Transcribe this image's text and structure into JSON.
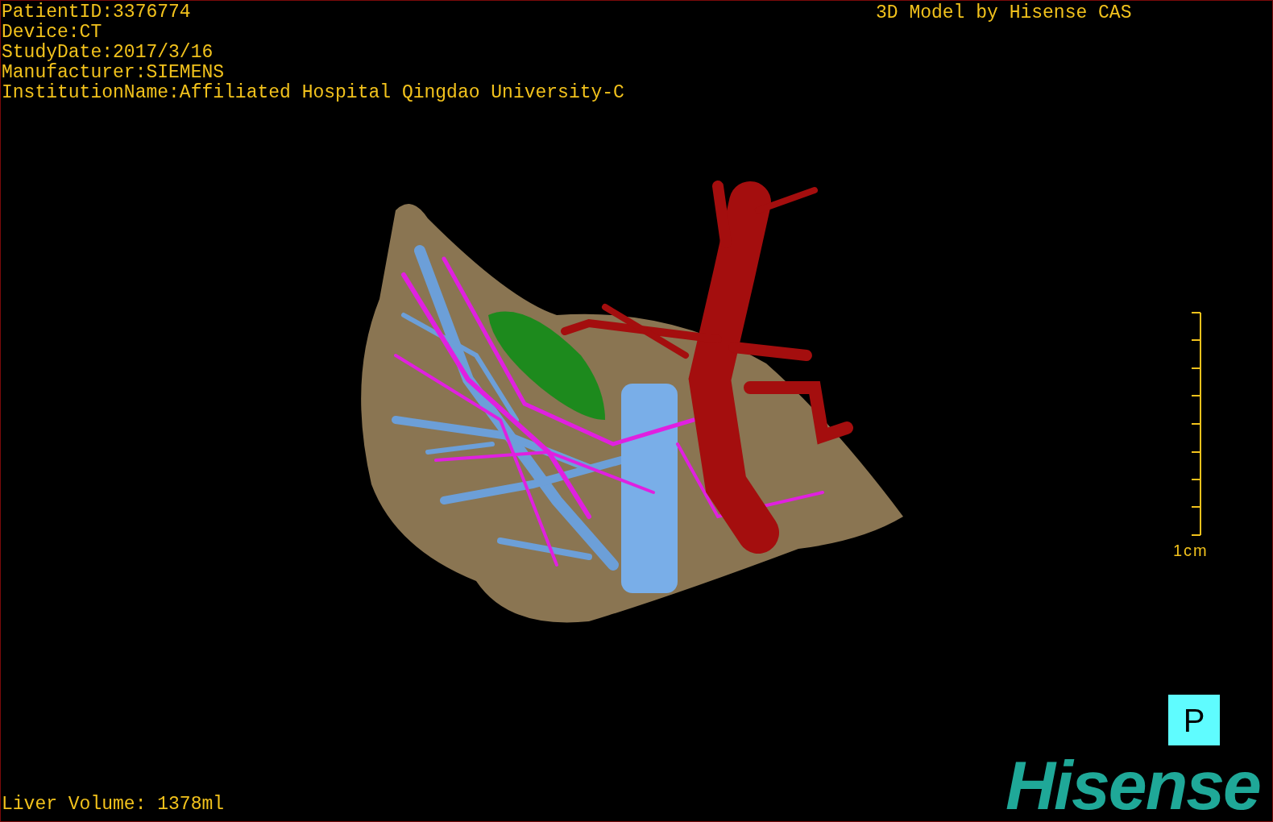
{
  "patient_info": [
    "PatientID:3376774",
    "Device:CT",
    "StudyDate:2017/3/16",
    "Manufacturer:SIEMENS",
    "InstitutionName:Affiliated Hospital Qingdao University-C"
  ],
  "title": "3D Model by Hisense CAS",
  "scale_bar": {
    "label": "1cm"
  },
  "orientation_button": {
    "label": "P"
  },
  "logo": "Hisense",
  "liver_volume": "Liver Volume: 1378ml"
}
